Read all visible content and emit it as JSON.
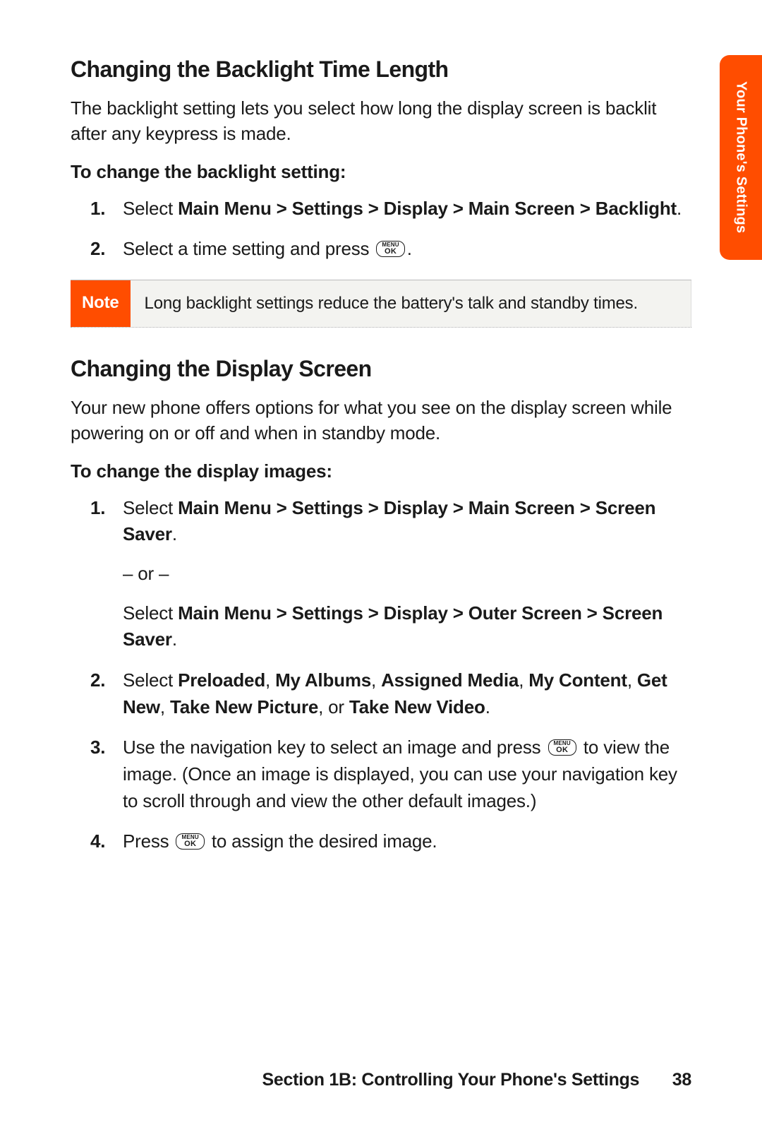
{
  "sideTab": "Your Phone's Settings",
  "key": {
    "top": "MENU",
    "bot": "OK"
  },
  "sections": [
    {
      "title": "Changing the Backlight Time Length",
      "intro": "The backlight setting lets you select how long the display screen is backlit after any keypress is made.",
      "subheading": "To change the backlight setting:",
      "steps": [
        {
          "type": "path",
          "prefix": "Select ",
          "boldPath": "Main Menu > Settings > Display > Main Screen > Backlight",
          "suffix": "."
        },
        {
          "type": "press-key",
          "prefix": "Select a time setting and press ",
          "suffix": "."
        }
      ],
      "note": {
        "label": "Note",
        "body": "Long backlight settings reduce the battery's talk and standby times."
      }
    },
    {
      "title": "Changing the Display Screen",
      "intro": "Your new phone offers options for what you see on the display screen while powering on or off and when in standby mode.",
      "subheading": "To change the display images:",
      "steps": [
        {
          "type": "dual-path",
          "prefix": "Select ",
          "boldPath": "Main Menu > Settings > Display > Main Screen > Screen Saver",
          "suffix": ".",
          "orText": "– or –",
          "prefix2": "Select ",
          "boldPath2": "Main Menu > Settings > Display > Outer Screen > Screen Saver",
          "suffix2": "."
        },
        {
          "type": "options",
          "prefix": "Select ",
          "opts": [
            "Preloaded",
            "My Albums",
            "Assigned Media",
            "My Content",
            "Get New",
            "Take New Picture"
          ],
          "joinOr": ", or ",
          "lastOpt": "Take New Video",
          "suffix": "."
        },
        {
          "type": "press-key-mid",
          "prefix": "Use the navigation key to select an image and press ",
          "tail": " to view the image. (Once an image is displayed, you can use your navigation key to scroll through and view the other default images.)"
        },
        {
          "type": "press-key",
          "prefix": "Press ",
          "suffix": " to assign the desired image."
        }
      ]
    }
  ],
  "footer": {
    "section": "Section 1B: Controlling Your Phone's Settings",
    "page": "38"
  }
}
